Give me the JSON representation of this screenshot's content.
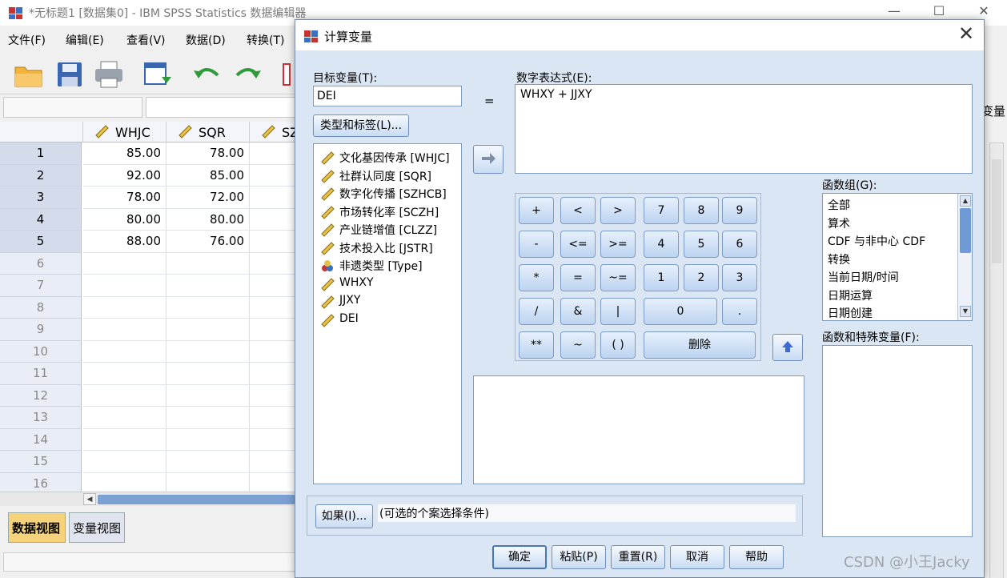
{
  "main_window": {
    "title": "*无标题1 [数据集0] - IBM SPSS Statistics 数据编辑器",
    "menu": [
      "文件(F)",
      "编辑(E)",
      "查看(V)",
      "数据(D)",
      "转换(T)"
    ],
    "right_header_fragment": "变量",
    "grid": {
      "columns": [
        "WHJC",
        "SQR",
        "SZ"
      ],
      "rows": [
        {
          "n": "1",
          "v": [
            "85.00",
            "78.00",
            ""
          ]
        },
        {
          "n": "2",
          "v": [
            "92.00",
            "85.00",
            ""
          ]
        },
        {
          "n": "3",
          "v": [
            "78.00",
            "72.00",
            ""
          ]
        },
        {
          "n": "4",
          "v": [
            "80.00",
            "80.00",
            ""
          ]
        },
        {
          "n": "5",
          "v": [
            "88.00",
            "76.00",
            ""
          ]
        },
        {
          "n": "6",
          "v": [
            "",
            "",
            ""
          ]
        },
        {
          "n": "7",
          "v": [
            "",
            "",
            ""
          ]
        },
        {
          "n": "8",
          "v": [
            "",
            "",
            ""
          ]
        },
        {
          "n": "9",
          "v": [
            "",
            "",
            ""
          ]
        },
        {
          "n": "10",
          "v": [
            "",
            "",
            ""
          ]
        },
        {
          "n": "11",
          "v": [
            "",
            "",
            ""
          ]
        },
        {
          "n": "12",
          "v": [
            "",
            "",
            ""
          ]
        },
        {
          "n": "13",
          "v": [
            "",
            "",
            ""
          ]
        },
        {
          "n": "14",
          "v": [
            "",
            "",
            ""
          ]
        },
        {
          "n": "15",
          "v": [
            "",
            "",
            ""
          ]
        },
        {
          "n": "16",
          "v": [
            "",
            "",
            ""
          ]
        }
      ]
    },
    "view_tabs": {
      "data_view": "数据视图",
      "variable_view": "变量视图"
    }
  },
  "dialog": {
    "title": "计算变量",
    "target_label": "目标变量(T):",
    "target_value": "DEI",
    "equals": "=",
    "type_label_button": "类型和标签(L)...",
    "expr_label": "数字表达式(E):",
    "expr_value": "WHXY + JJXY",
    "variables": [
      {
        "label": "文化基因传承 [WHJC]",
        "icon": "scale-ruler-icon"
      },
      {
        "label": "社群认同度 [SQR]",
        "icon": "scale-ruler-icon"
      },
      {
        "label": "数字化传播 [SZHCB]",
        "icon": "scale-ruler-icon"
      },
      {
        "label": "市场转化率 [SCZH]",
        "icon": "scale-ruler-icon"
      },
      {
        "label": "产业链增值 [CLZZ]",
        "icon": "scale-ruler-icon"
      },
      {
        "label": "技术投入比 [JSTR]",
        "icon": "scale-ruler-icon"
      },
      {
        "label": "非遗类型 [Type]",
        "icon": "nominal-icon"
      },
      {
        "label": "WHXY",
        "icon": "scale-ruler-icon"
      },
      {
        "label": "JJXY",
        "icon": "scale-ruler-icon"
      },
      {
        "label": "DEI",
        "icon": "scale-ruler-icon"
      }
    ],
    "keypad": {
      "row1": [
        "+",
        "<",
        ">",
        "7",
        "8",
        "9"
      ],
      "row2": [
        "-",
        "<=",
        ">=",
        "4",
        "5",
        "6"
      ],
      "row3": [
        "*",
        "=",
        "~=",
        "1",
        "2",
        "3"
      ],
      "row4": [
        "/",
        "&",
        "|",
        "0",
        "."
      ],
      "row5": [
        "**",
        "~",
        "( )",
        "删除"
      ]
    },
    "function_group_label": "函数组(G):",
    "function_groups": [
      "全部",
      "算术",
      "CDF 与非中心 CDF",
      "转换",
      "当前日期/时间",
      "日期运算",
      "日期创建"
    ],
    "functions_label": "函数和特殊变量(F):",
    "if_button": "如果(I)...",
    "if_condition": "(可选的个案选择条件)",
    "buttons": {
      "ok": "确定",
      "paste": "粘贴(P)",
      "reset": "重置(R)",
      "cancel": "取消",
      "help": "帮助"
    }
  },
  "watermark": "CSDN @小王Jacky"
}
